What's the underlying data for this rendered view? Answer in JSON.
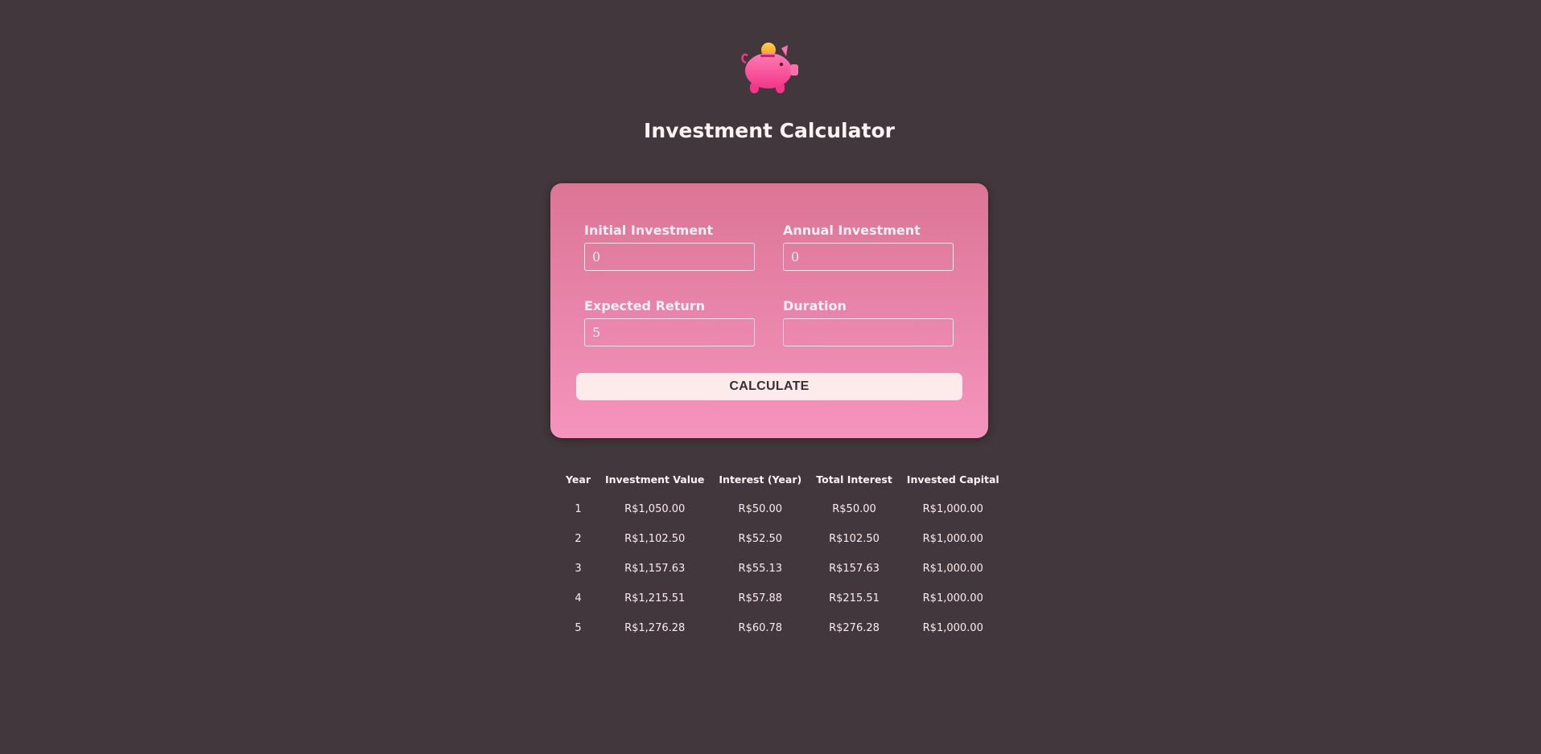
{
  "header": {
    "logo_icon": "piggy-bank-icon",
    "title": "Investment Calculator"
  },
  "form": {
    "initial_investment": {
      "label": "Initial Investment",
      "value": "0"
    },
    "annual_investment": {
      "label": "Annual Investment",
      "value": "0"
    },
    "expected_return": {
      "label": "Expected Return",
      "value": "5"
    },
    "duration": {
      "label": "Duration",
      "value": ""
    },
    "calculate_label": "CALCULATE"
  },
  "results": {
    "columns": [
      "Year",
      "Investment Value",
      "Interest (Year)",
      "Total Interest",
      "Invested Capital"
    ],
    "rows": [
      [
        "1",
        "R$1,050.00",
        "R$50.00",
        "R$50.00",
        "R$1,000.00"
      ],
      [
        "2",
        "R$1,102.50",
        "R$52.50",
        "R$102.50",
        "R$1,000.00"
      ],
      [
        "3",
        "R$1,157.63",
        "R$55.13",
        "R$157.63",
        "R$1,000.00"
      ],
      [
        "4",
        "R$1,215.51",
        "R$57.88",
        "R$215.51",
        "R$1,000.00"
      ],
      [
        "5",
        "R$1,276.28",
        "R$60.78",
        "R$276.28",
        "R$1,000.00"
      ]
    ]
  },
  "colors": {
    "background": "#41373c",
    "card_top": "#dc7596",
    "card_bottom": "#f594bd",
    "button_bg": "#fdebec",
    "pig": "#ff5a9e",
    "coin": "#fbb034"
  }
}
